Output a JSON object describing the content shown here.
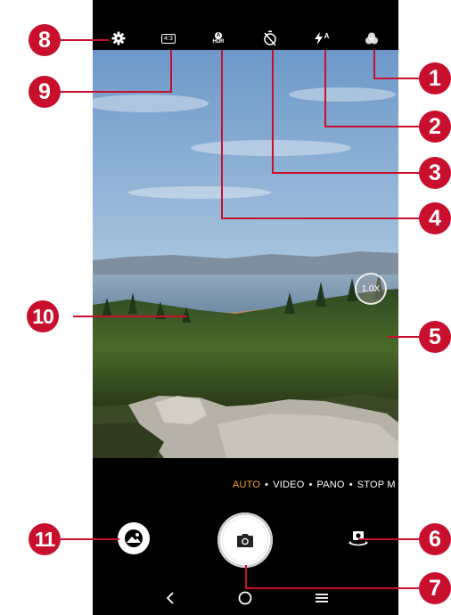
{
  "top_bar": {
    "icons": [
      "settings-gear-icon",
      "aspect-ratio-icon",
      "hdr-auto-icon",
      "timer-off-icon",
      "flash-auto-icon",
      "filter-icon"
    ],
    "aspect_ratio_label": "4:3",
    "hdr_label": "HDR",
    "hdr_badge": "A",
    "flash_badge": "A"
  },
  "zoom": {
    "label": "1.0X"
  },
  "modes": {
    "items": [
      "AUTO",
      "VIDEO",
      "PANO",
      "STOP M"
    ],
    "active": "AUTO",
    "separator": "•"
  },
  "bottom_controls": {
    "icons": [
      "gallery-thumbnail-icon",
      "shutter-camera-icon",
      "switch-camera-icon"
    ]
  },
  "navigation": {
    "icons": [
      "back-icon",
      "home-icon",
      "recents-icon"
    ]
  },
  "callouts": [
    "1",
    "2",
    "3",
    "4",
    "5",
    "6",
    "7",
    "8",
    "9",
    "10",
    "11"
  ],
  "colors": {
    "callout_red": "#c8102e",
    "active_mode": "#f5a623",
    "phone_background": "#000000"
  }
}
